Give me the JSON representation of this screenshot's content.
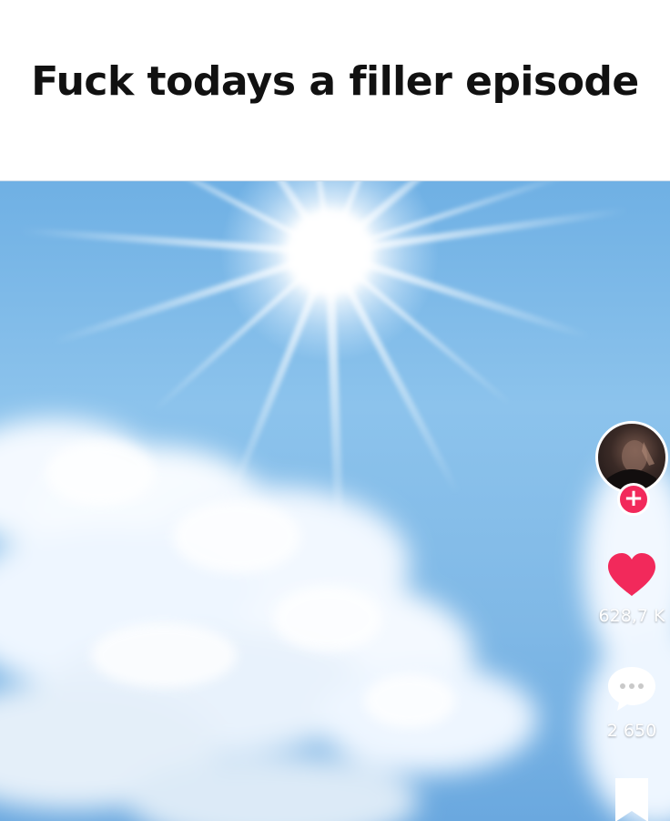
{
  "caption": {
    "text": "Fuck todays a filler episode"
  },
  "video": {
    "scene": "sunny sky with clouds"
  },
  "actions": {
    "like_count": "628,7 K",
    "comment_count": "2 650"
  },
  "colors": {
    "sky": "#7fb8e6",
    "like_heart": "#f2295b",
    "follow_button": "#f2295b",
    "caption_text": "#111111"
  },
  "icons": {
    "like": "heart-icon",
    "comment": "speech-bubble-icon",
    "save": "bookmark-icon",
    "follow": "plus-icon"
  }
}
